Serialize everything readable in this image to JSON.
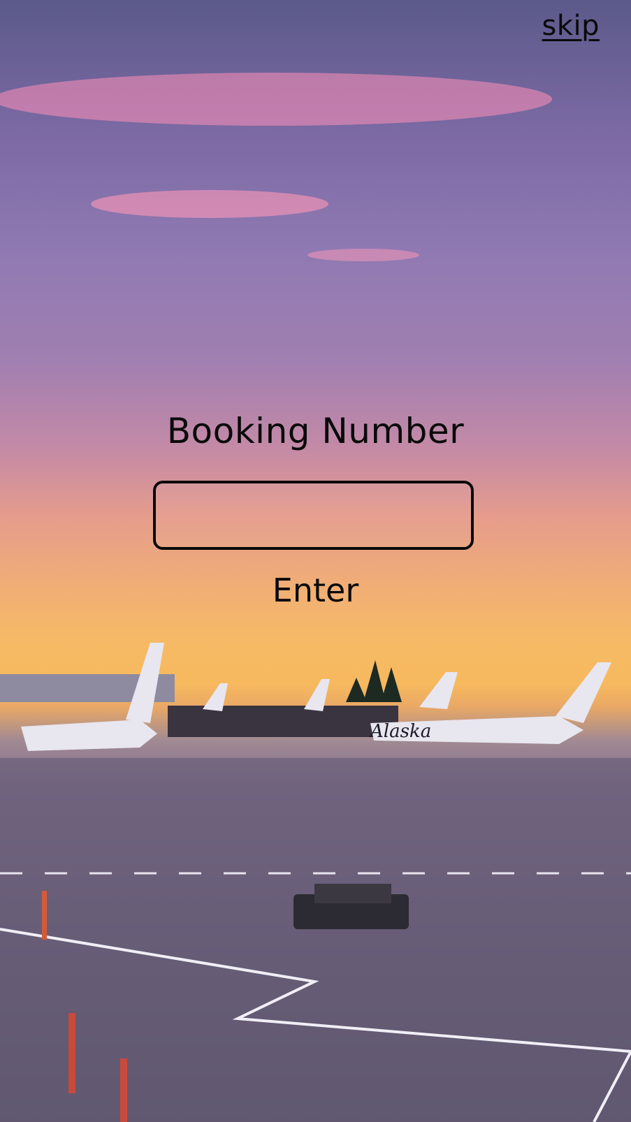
{
  "header": {
    "skip_label": "skip"
  },
  "form": {
    "title": "Booking Number",
    "input_value": "",
    "input_placeholder": "",
    "enter_label": "Enter"
  },
  "background": {
    "plane_livery_text": "Alaska"
  }
}
